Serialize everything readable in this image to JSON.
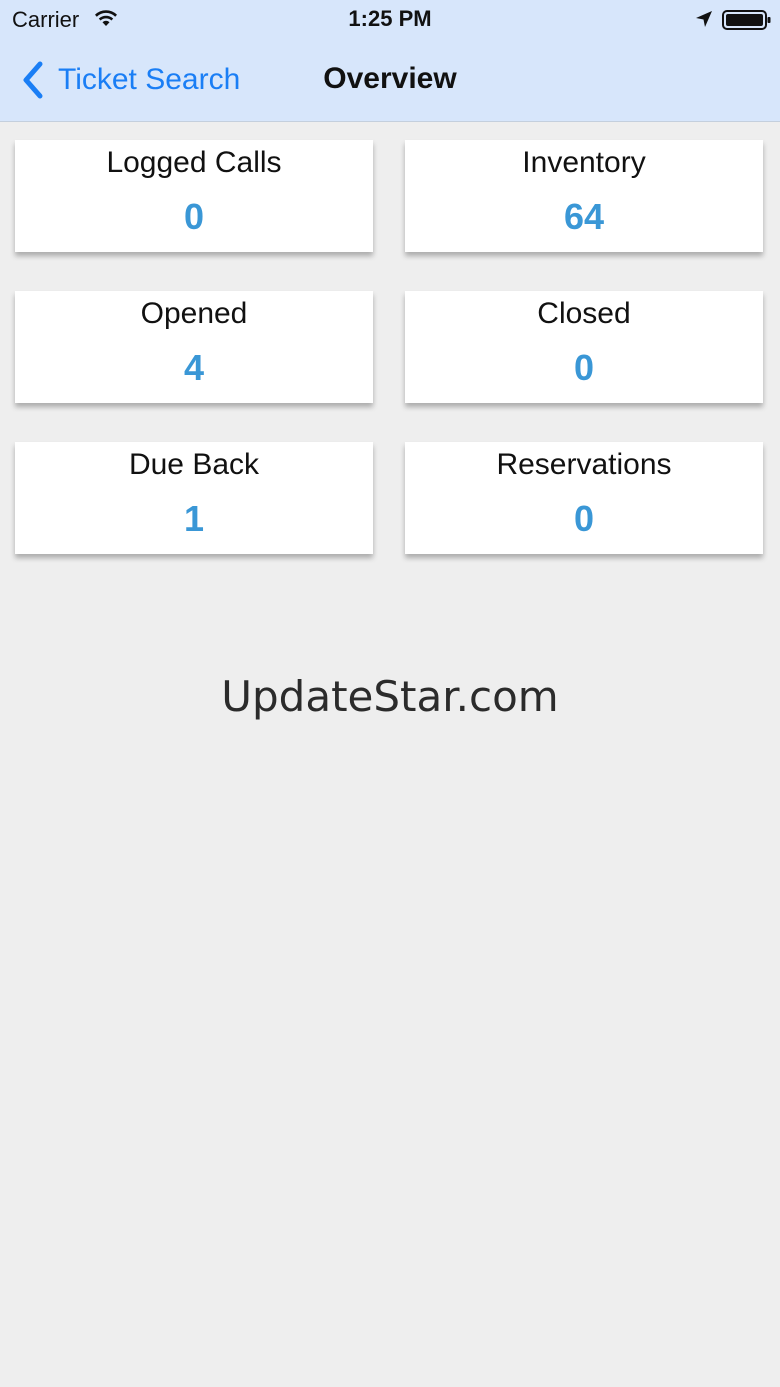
{
  "status_bar": {
    "carrier": "Carrier",
    "time": "1:25 PM",
    "icons": [
      "wifi-icon",
      "location-icon",
      "battery-icon"
    ]
  },
  "nav": {
    "back_label": "Ticket Search",
    "title": "Overview"
  },
  "cards": [
    {
      "label": "Logged Calls",
      "value": "0"
    },
    {
      "label": "Inventory",
      "value": "64"
    },
    {
      "label": "Opened",
      "value": "4"
    },
    {
      "label": "Closed",
      "value": "0"
    },
    {
      "label": "Due Back",
      "value": "1"
    },
    {
      "label": "Reservations",
      "value": "0"
    }
  ],
  "watermark": "UpdateStar.com",
  "colors": {
    "accent": "#1a7ef5",
    "value": "#3a97d6",
    "header_bg": "#d7e6fb",
    "page_bg": "#eeeeee"
  }
}
